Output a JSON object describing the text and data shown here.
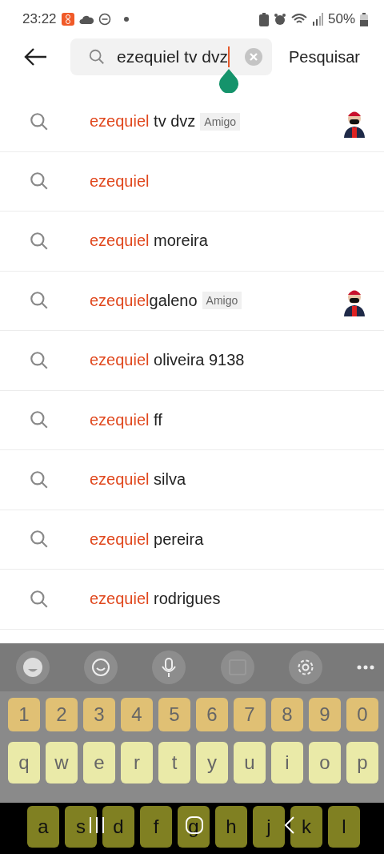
{
  "status_bar": {
    "time": "23:22",
    "battery": "50%"
  },
  "search": {
    "value": "ezequiel tv dvz",
    "action": "Pesquisar"
  },
  "suggestions": [
    {
      "match": "ezequiel",
      "rest": " tv dvz",
      "tag": "Amigo",
      "avatar": true
    },
    {
      "match": "ezequiel",
      "avatar": false
    },
    {
      "match": "ezequiel",
      "rest": " moreira",
      "avatar": false
    },
    {
      "match": "ezequiel",
      "rest": "galeno",
      "tag": "Amigo",
      "avatar": true
    },
    {
      "match": "ezequiel",
      "rest": " oliveira 9138",
      "avatar": false
    },
    {
      "match": "ezequiel",
      "rest": " ff",
      "avatar": false
    },
    {
      "match": "ezequiel",
      "rest": " silva",
      "avatar": false
    },
    {
      "match": "ezequiel",
      "rest": " pereira",
      "avatar": false
    },
    {
      "match": "ezequiel",
      "rest": " rodrigues",
      "avatar": false
    }
  ],
  "keyboard": {
    "rows": [
      {
        "kind": "number",
        "keys": [
          "1",
          "2",
          "3",
          "4",
          "5",
          "6",
          "7",
          "8",
          "9",
          "0"
        ]
      },
      {
        "kind": "letter",
        "keys": [
          "q",
          "w",
          "e",
          "r",
          "t",
          "y",
          "u",
          "i",
          "o",
          "p"
        ]
      },
      {
        "kind": "home",
        "keys": [
          "a",
          "s",
          "d",
          "f",
          "g",
          "h",
          "j",
          "k",
          "l"
        ]
      }
    ]
  }
}
